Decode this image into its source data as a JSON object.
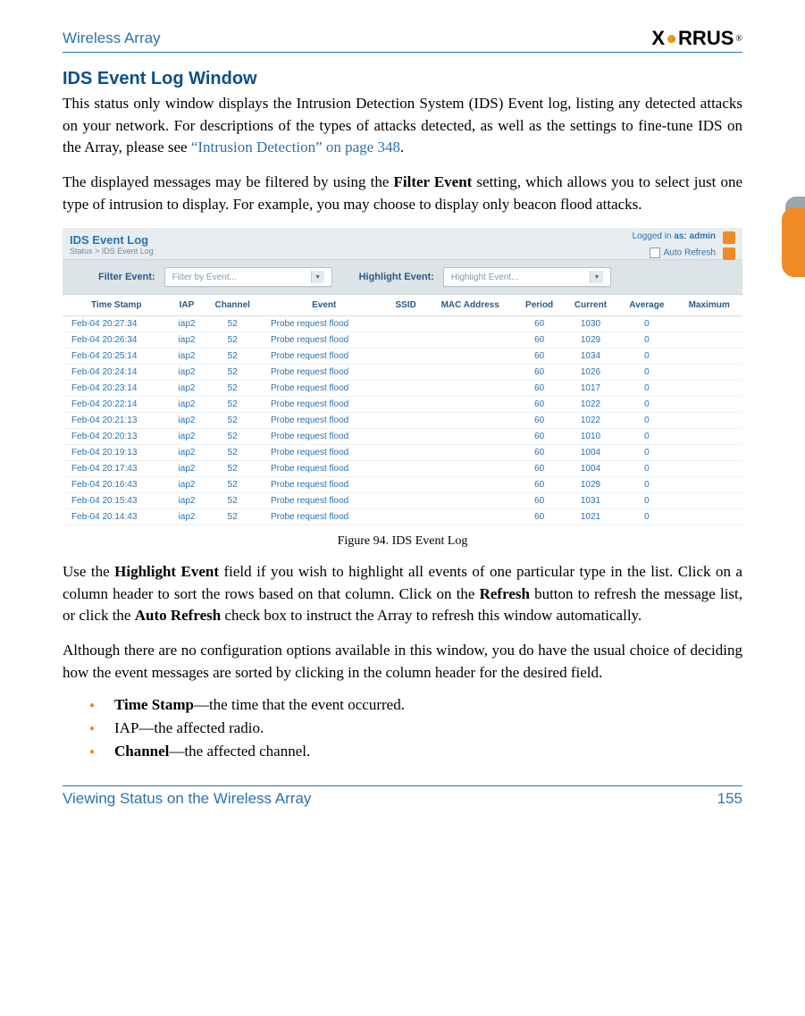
{
  "header": {
    "left": "Wireless Array",
    "logo_text": "XIRRUS"
  },
  "title": "IDS Event Log Window",
  "para1_a": "This status only window displays the Intrusion Detection System (IDS) Event log, listing any detected attacks on your network. For descriptions of the types of attacks detected, as well as the settings to fine-tune IDS on the Array, please see ",
  "para1_link": "“Intrusion Detection” on page 348",
  "para1_b": ".",
  "para2_a": "The displayed messages may be filtered by using the ",
  "para2_bold1": "Filter Event",
  "para2_b": " setting, which allows you to select just one type of intrusion to display. For example, you may choose to display only beacon flood attacks.",
  "shot": {
    "title": "IDS Event Log",
    "breadcrumb": "Status > IDS Event Log",
    "logged_prefix": "Logged in ",
    "logged_as": "as: ",
    "logged_user": "admin",
    "auto_refresh": "Auto Refresh",
    "filter_label": "Filter Event:",
    "filter_placeholder": "Filter by Event...",
    "highlight_label": "Highlight Event:",
    "highlight_placeholder": "Highlight Event...",
    "columns": [
      "Time Stamp",
      "IAP",
      "Channel",
      "Event",
      "SSID",
      "MAC Address",
      "Period",
      "Current",
      "Average",
      "Maximum"
    ],
    "rows": [
      {
        "ts": "Feb-04 20:27:34",
        "iap": "iap2",
        "ch": "52",
        "ev": "Probe request flood",
        "ssid": "",
        "mac": "",
        "per": "60",
        "cur": "1030",
        "avg": "0",
        "max": ""
      },
      {
        "ts": "Feb-04 20:26:34",
        "iap": "iap2",
        "ch": "52",
        "ev": "Probe request flood",
        "ssid": "",
        "mac": "",
        "per": "60",
        "cur": "1029",
        "avg": "0",
        "max": ""
      },
      {
        "ts": "Feb-04 20:25:14",
        "iap": "iap2",
        "ch": "52",
        "ev": "Probe request flood",
        "ssid": "",
        "mac": "",
        "per": "60",
        "cur": "1034",
        "avg": "0",
        "max": ""
      },
      {
        "ts": "Feb-04 20:24:14",
        "iap": "iap2",
        "ch": "52",
        "ev": "Probe request flood",
        "ssid": "",
        "mac": "",
        "per": "60",
        "cur": "1026",
        "avg": "0",
        "max": ""
      },
      {
        "ts": "Feb-04 20:23:14",
        "iap": "iap2",
        "ch": "52",
        "ev": "Probe request flood",
        "ssid": "",
        "mac": "",
        "per": "60",
        "cur": "1017",
        "avg": "0",
        "max": ""
      },
      {
        "ts": "Feb-04 20:22:14",
        "iap": "iap2",
        "ch": "52",
        "ev": "Probe request flood",
        "ssid": "",
        "mac": "",
        "per": "60",
        "cur": "1022",
        "avg": "0",
        "max": ""
      },
      {
        "ts": "Feb-04 20:21:13",
        "iap": "iap2",
        "ch": "52",
        "ev": "Probe request flood",
        "ssid": "",
        "mac": "",
        "per": "60",
        "cur": "1022",
        "avg": "0",
        "max": ""
      },
      {
        "ts": "Feb-04 20:20:13",
        "iap": "iap2",
        "ch": "52",
        "ev": "Probe request flood",
        "ssid": "",
        "mac": "",
        "per": "60",
        "cur": "1010",
        "avg": "0",
        "max": ""
      },
      {
        "ts": "Feb-04 20:19:13",
        "iap": "iap2",
        "ch": "52",
        "ev": "Probe request flood",
        "ssid": "",
        "mac": "",
        "per": "60",
        "cur": "1004",
        "avg": "0",
        "max": ""
      },
      {
        "ts": "Feb-04 20:17:43",
        "iap": "iap2",
        "ch": "52",
        "ev": "Probe request flood",
        "ssid": "",
        "mac": "",
        "per": "60",
        "cur": "1004",
        "avg": "0",
        "max": ""
      },
      {
        "ts": "Feb-04 20:16:43",
        "iap": "iap2",
        "ch": "52",
        "ev": "Probe request flood",
        "ssid": "",
        "mac": "",
        "per": "60",
        "cur": "1029",
        "avg": "0",
        "max": ""
      },
      {
        "ts": "Feb-04 20:15:43",
        "iap": "iap2",
        "ch": "52",
        "ev": "Probe request flood",
        "ssid": "",
        "mac": "",
        "per": "60",
        "cur": "1031",
        "avg": "0",
        "max": ""
      },
      {
        "ts": "Feb-04 20:14:43",
        "iap": "iap2",
        "ch": "52",
        "ev": "Probe request flood",
        "ssid": "",
        "mac": "",
        "per": "60",
        "cur": "1021",
        "avg": "0",
        "max": ""
      }
    ]
  },
  "figure_caption": "Figure 94. IDS Event Log",
  "para3_a": "Use the ",
  "para3_bold1": "Highlight Event",
  "para3_b": " field if you wish to highlight all events of one particular type in the list. Click on a column header to sort the rows based on that column. Click on the ",
  "para3_bold2": "Refresh",
  "para3_c": " button to refresh the message list, or click the ",
  "para3_bold3": "Auto Refresh",
  "para3_d": " check box to instruct the Array to refresh this window automatically.",
  "para4": "Although there are no configuration options available in this window, you do have the usual choice of deciding how the event messages are sorted by clicking in the column header for the desired field.",
  "bullets": [
    {
      "bold": "Time Stamp",
      "rest": "—the time that the event occurred."
    },
    {
      "bold": "",
      "rest": "IAP—the affected radio."
    },
    {
      "bold": "Channel",
      "rest": "—the affected channel."
    }
  ],
  "footer": {
    "left": "Viewing Status on the Wireless Array",
    "right": "155"
  }
}
